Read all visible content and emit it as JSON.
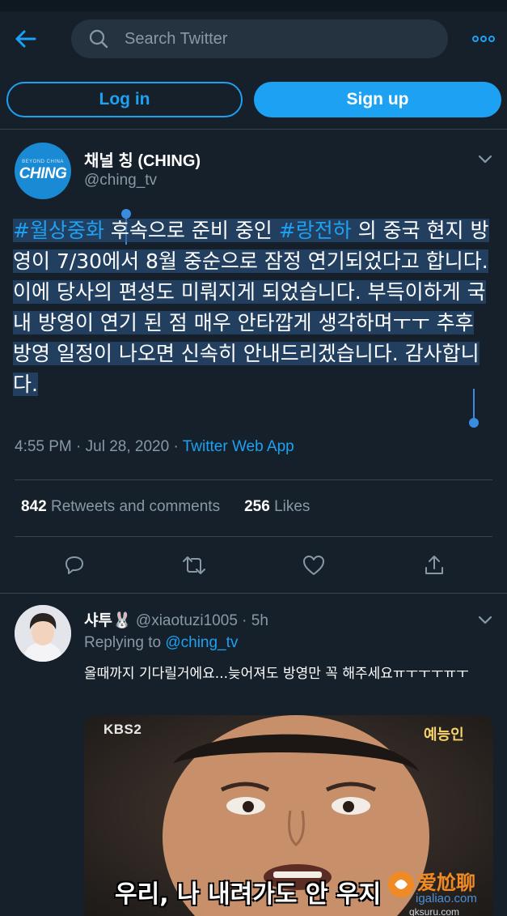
{
  "header": {
    "search_placeholder": "Search Twitter",
    "login_label": "Log in",
    "signup_label": "Sign up"
  },
  "tweet": {
    "avatar_small": "BEYOND CHINA",
    "avatar_big": "CHING",
    "author_name": "채널 칭 (CHING)",
    "author_handle": "@ching_tv",
    "tag1": "#월상중화",
    "text1": " 후속으로 준비 중인 ",
    "tag2": "#랑전하",
    "text2": " 의 중국 현지 방영이 7/30에서 8월 중순으로 잠정 연기되었다고 합니다. 이에 당사의 편성도 미뤄지게 되었습니다. 부득이하게 국내 방영이 연기 된 점 매우 안타깝게 생각하며ㅜㅜ 추후 방영 일정이 나오면 신속히 안내드리겠습니다. 감사합니다.",
    "time": "4:55 PM · Jul 28, 2020 · ",
    "source": "Twitter Web App",
    "retweets_count": "842",
    "retweets_label": "Retweets and comments",
    "likes_count": "256",
    "likes_label": "Likes"
  },
  "reply": {
    "name": "샤투🐰",
    "handle_time": " @xiaotuzi1005 · 5h",
    "replying_prefix": "Replying to ",
    "replying_to": "@ching_tv",
    "text": "올때까지 기다릴거에요...늦어져도 방영만 꼭 해주세요ㅠㅜㅜㅜㅠㅜ",
    "media": {
      "channel_logo": "KBS2",
      "show_logo": "예능인",
      "subtitle": "우리, 나 내려가도 안 우지"
    }
  },
  "watermark": {
    "title": "爱尬聊",
    "url": "igaliao.com",
    "url2": "qksuru.com"
  },
  "colors": {
    "background": "#15202b",
    "accent": "#1da1f2",
    "secondary_text": "#8899a6",
    "border": "#38444d"
  },
  "icons": [
    "back-arrow-icon",
    "search-icon",
    "more-icon",
    "chevron-down-icon",
    "reply-icon",
    "retweet-icon",
    "like-icon",
    "share-icon"
  ]
}
